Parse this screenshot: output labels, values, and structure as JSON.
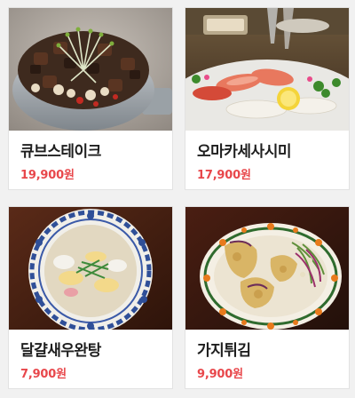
{
  "colors": {
    "price": "#e8474b",
    "name": "#1e1e1e",
    "card_bg": "#ffffff",
    "page_bg": "#f1f1f1"
  },
  "menu": {
    "items": [
      {
        "name": "큐브스테이크",
        "price": "19,900원",
        "image": "cube-steak-photo"
      },
      {
        "name": "오마카세사시미",
        "price": "17,900원",
        "image": "omakase-sashimi-photo"
      },
      {
        "name": "달걀새우완탕",
        "price": "7,900원",
        "image": "egg-shrimp-wonton-soup-photo"
      },
      {
        "name": "가지튀김",
        "price": "9,900원",
        "image": "fried-eggplant-photo"
      }
    ]
  }
}
